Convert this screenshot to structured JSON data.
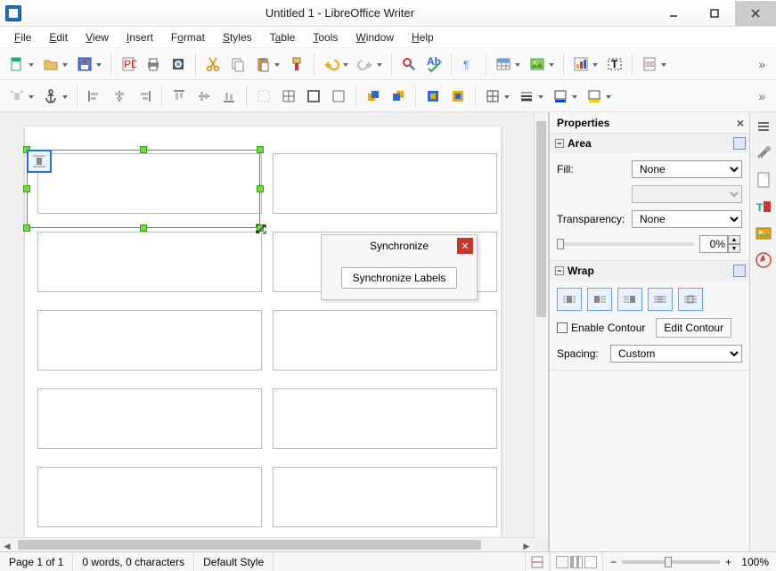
{
  "window": {
    "title": "Untitled 1 - LibreOffice Writer"
  },
  "menu": [
    "File",
    "Edit",
    "View",
    "Insert",
    "Format",
    "Styles",
    "Table",
    "Tools",
    "Window",
    "Help"
  ],
  "sync": {
    "title": "Synchronize",
    "button": "Synchronize Labels"
  },
  "sidebar": {
    "title": "Properties",
    "area": {
      "title": "Area",
      "fill_label": "Fill:",
      "fill_value": "None",
      "transparency_label": "Transparency:",
      "transparency_value": "None",
      "transparency_pct": "0%"
    },
    "wrap": {
      "title": "Wrap",
      "enable_contour": "Enable Contour",
      "edit_contour": "Edit Contour",
      "spacing_label": "Spacing:",
      "spacing_value": "Custom"
    }
  },
  "status": {
    "page": "Page 1 of 1",
    "words": "0 words, 0 characters",
    "style": "Default Style",
    "zoom": "100%"
  }
}
